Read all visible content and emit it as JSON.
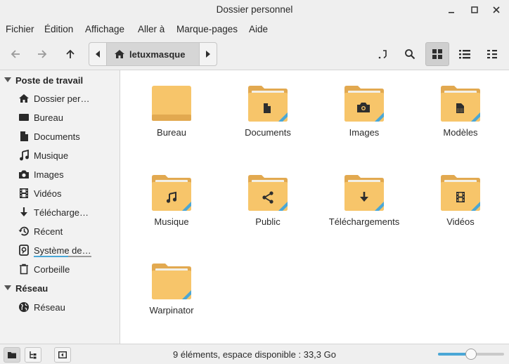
{
  "window": {
    "title": "Dossier personnel"
  },
  "menu": [
    "Fichier",
    "Édition",
    "Affichage",
    "Aller à",
    "Marque-pages",
    "Aide"
  ],
  "toolbar": {
    "path_current": "letuxmasque",
    "view_mode": "icons"
  },
  "sidebar": {
    "sections": [
      {
        "label": "Poste de travail",
        "items": [
          {
            "label": "Dossier per…",
            "icon": "home-icon"
          },
          {
            "label": "Bureau",
            "icon": "desktop-icon"
          },
          {
            "label": "Documents",
            "icon": "document-icon"
          },
          {
            "label": "Musique",
            "icon": "music-icon"
          },
          {
            "label": "Images",
            "icon": "camera-icon"
          },
          {
            "label": "Vidéos",
            "icon": "film-icon"
          },
          {
            "label": "Télécharge…",
            "icon": "download-icon"
          },
          {
            "label": "Récent",
            "icon": "recent-icon"
          },
          {
            "label": "Système de…",
            "icon": "drive-icon",
            "usage": 0.6
          },
          {
            "label": "Corbeille",
            "icon": "trash-icon"
          }
        ]
      },
      {
        "label": "Réseau",
        "items": [
          {
            "label": "Réseau",
            "icon": "globe-icon"
          }
        ]
      }
    ]
  },
  "files": [
    {
      "name": "Bureau",
      "emblem": "none"
    },
    {
      "name": "Documents",
      "emblem": "document-icon"
    },
    {
      "name": "Images",
      "emblem": "camera-icon"
    },
    {
      "name": "Modèles",
      "emblem": "template-icon"
    },
    {
      "name": "Musique",
      "emblem": "music-icon"
    },
    {
      "name": "Public",
      "emblem": "share-icon"
    },
    {
      "name": "Téléchargements",
      "emblem": "download-icon"
    },
    {
      "name": "Vidéos",
      "emblem": "film-icon"
    },
    {
      "name": "Warpinator",
      "emblem": "none"
    }
  ],
  "status": {
    "text": "9 éléments, espace disponible : 33,3 Go",
    "zoom": 0.5
  },
  "colors": {
    "folder": "#f7c56a",
    "folder_dark": "#e2a950",
    "accent": "#4aa7d6"
  }
}
